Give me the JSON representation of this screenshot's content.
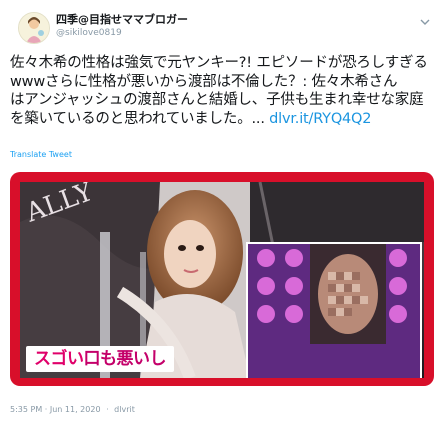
{
  "tweet": {
    "display_name": "四季@目指せママブロガー",
    "handle": "@sikilove0819",
    "text_lines": [
      "佐々木希の性格は強気で元ヤンキー?! エピソードが恐ろしすぎる",
      "wwwさらに性格が悪いから渡部は不倫した？: 佐々木希さん",
      "はアンジャッシュの渡部さんと結婚し、子供も生まれ幸せな家庭"
    ],
    "last_line_text": "を築いているのと思われていました。...",
    "link_text": "dlvr.it/RYQ4Q2",
    "translate_label": "Translate Tweet",
    "media_caption_part1": "スゴい",
    "media_caption_part2": "口も悪いし",
    "timestamp": "5:35 PM · Jun 11, 2020",
    "separator": "·",
    "source": "dlvrit"
  },
  "icons": [
    "avatar",
    "chevron-down-icon"
  ],
  "colors": {
    "link": "#1b95e0",
    "media_border": "#d80f2a",
    "caption_pink": "#e0006a"
  }
}
